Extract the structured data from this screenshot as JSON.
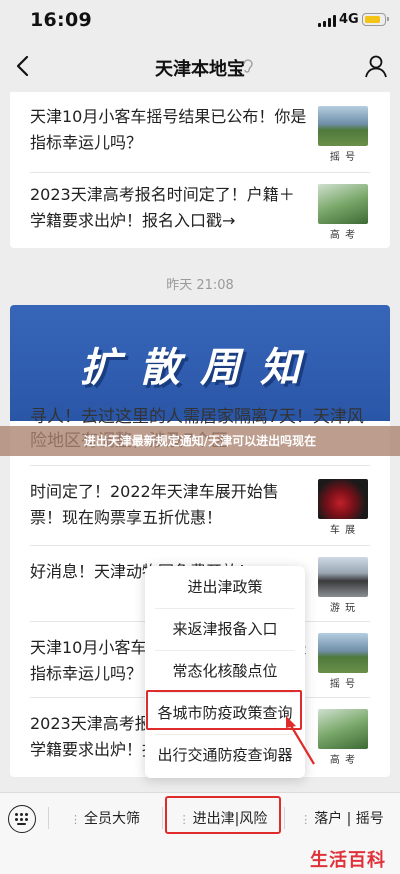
{
  "status_bar": {
    "time": "16:09",
    "network": "4G"
  },
  "nav": {
    "title": "天津本地宝"
  },
  "card1": {
    "items": [
      {
        "title": "天津10月小客车摇号结果已公布！你是指标幸运儿吗？",
        "thumb_label": "摇 号"
      },
      {
        "title": "2023天津高考报名时间定了！户籍＋学籍要求出炉！报名入口戳→",
        "thumb_label": "高 考"
      }
    ]
  },
  "timestamp": "昨天 21:08",
  "card2": {
    "banner_text": "扩散周知",
    "headline": "寻人！去过这里的人需居家隔离7天！天津风险地区有调整，涉及7个区",
    "items": [
      {
        "title": "时间定了！2022年天津车展开始售票！现在购票享五折优惠！",
        "thumb_label": "车 展"
      },
      {
        "title": "好消息！天津动物园免费开放！",
        "thumb_label": "游 玩"
      },
      {
        "title": "天津10月小客车摇号结果已公布！你是指标幸运儿吗？",
        "thumb_label": "摇 号"
      },
      {
        "title": "2023天津高考报名时间定了！户籍＋学籍要求出炉！报名入口戳→",
        "thumb_label": "高 考"
      }
    ]
  },
  "overlay_caption": "进出天津最新规定通知/天津可以进出吗现在",
  "popup_menu": {
    "items": [
      "进出津政策",
      "来返津报备入口",
      "常态化核酸点位",
      "各城市防疫政策查询",
      "出行交通防疫查询器"
    ],
    "highlighted_index": 3
  },
  "bottom_menu": {
    "tabs": [
      "全员大筛",
      "进出津|风险",
      "落户 | 摇号"
    ],
    "highlighted_index": 1
  },
  "watermark": "生活百科",
  "colors": {
    "highlight": "#e02b2b",
    "banner": "#3766b8",
    "watermark": "#e0323a"
  }
}
